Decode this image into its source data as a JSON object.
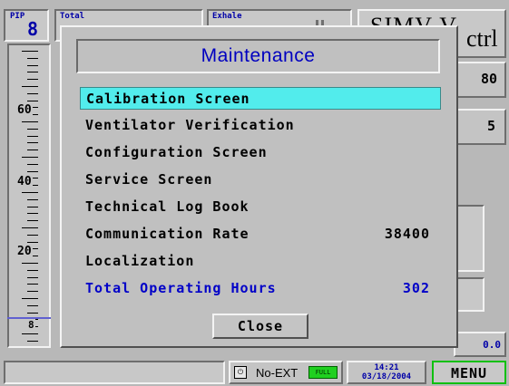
{
  "top": {
    "pip": {
      "label": "PIP",
      "value": "8"
    },
    "total_label": "Total",
    "exhale_label": "Exhale",
    "mode_text": "SIMV-V",
    "ctrl_text": "ctrl"
  },
  "right_panel": {
    "value_1": "80",
    "value_2": "5",
    "bottom_value": "0.0"
  },
  "scale": {
    "labels": [
      "60",
      "40",
      "20"
    ],
    "marker": "8",
    "marker_value": 8
  },
  "dialog": {
    "title": "Maintenance",
    "items": [
      {
        "label": "Calibration Screen",
        "value": ""
      },
      {
        "label": "Ventilator Verification",
        "value": ""
      },
      {
        "label": "Configuration Screen",
        "value": ""
      },
      {
        "label": "Service Screen",
        "value": ""
      },
      {
        "label": "Technical Log Book",
        "value": ""
      },
      {
        "label": "Communication Rate",
        "value": "38400"
      },
      {
        "label": "Localization",
        "value": ""
      },
      {
        "label": "Total Operating Hours",
        "value": "302"
      }
    ],
    "close_label": "Close"
  },
  "status": {
    "no_ext": "No-EXT",
    "battery_label": "FULL",
    "time": "14:21",
    "date": "03/18/2004",
    "menu_label": "MENU"
  },
  "colors": {
    "selection": "#52ecec",
    "title_blue": "#0000c0",
    "menu_green": "#10c010",
    "battery_green": "#20d020"
  }
}
